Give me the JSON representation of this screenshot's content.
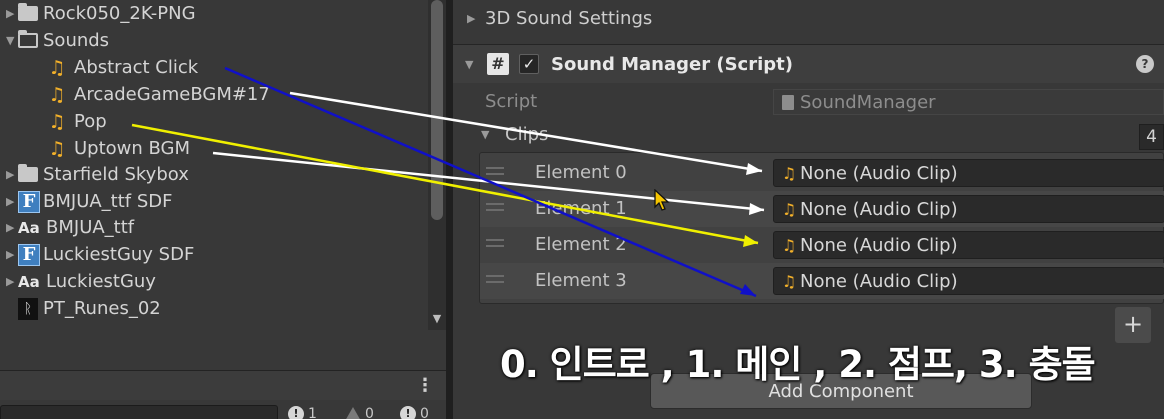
{
  "project": {
    "items": [
      {
        "label": "Rock050_2K-PNG",
        "icon": "folder-icon"
      },
      {
        "label": "Sounds",
        "icon": "folder-open-icon"
      },
      {
        "label": "Abstract Click",
        "icon": "audio-icon"
      },
      {
        "label": "ArcadeGameBGM#17",
        "icon": "audio-icon"
      },
      {
        "label": "Pop",
        "icon": "audio-icon"
      },
      {
        "label": "Uptown BGM",
        "icon": "audio-icon"
      },
      {
        "label": "Starfield Skybox",
        "icon": "folder-icon"
      },
      {
        "label": "BMJUA_ttf SDF",
        "icon": "font-asset-icon"
      },
      {
        "label": "BMJUA_ttf",
        "icon": "font-icon"
      },
      {
        "label": "LuckiestGuy SDF",
        "icon": "font-asset-icon"
      },
      {
        "label": "LuckiestGuy",
        "icon": "font-icon"
      },
      {
        "label": "PT_Runes_02",
        "icon": "texture-icon"
      }
    ],
    "font_asset_glyph": "F",
    "font_glyph": "Aa"
  },
  "console": {
    "error_count": "1",
    "warning_count": "0",
    "message_count": "0"
  },
  "inspector": {
    "sound_settings_label": "3D Sound Settings",
    "component_title": "Sound Manager (Script)",
    "script_label": "Script",
    "script_value": "SoundManager",
    "clips_label": "Clips",
    "clips_size": "4",
    "elements": [
      {
        "label": "Element 0",
        "value": "None (Audio Clip)"
      },
      {
        "label": "Element 1",
        "value": "None (Audio Clip)"
      },
      {
        "label": "Element 2",
        "value": "None (Audio Clip)"
      },
      {
        "label": "Element 3",
        "value": "None (Audio Clip)"
      }
    ],
    "add_element_label": "+",
    "add_component_label": "Add Component"
  },
  "overlay": {
    "caption": "0. 인트로 , 1. 메인 , 2. 점프, 3. 충돌",
    "arrow_colors": {
      "abstract_click": "#1010c8",
      "arcade_bgm": "#ffffff",
      "pop": "#f0f000",
      "uptown_bgm": "#ffffff"
    }
  },
  "colors": {
    "audio_note": "#f2b02a",
    "panel_bg": "#383838",
    "field_bg": "#2a2a2a"
  }
}
